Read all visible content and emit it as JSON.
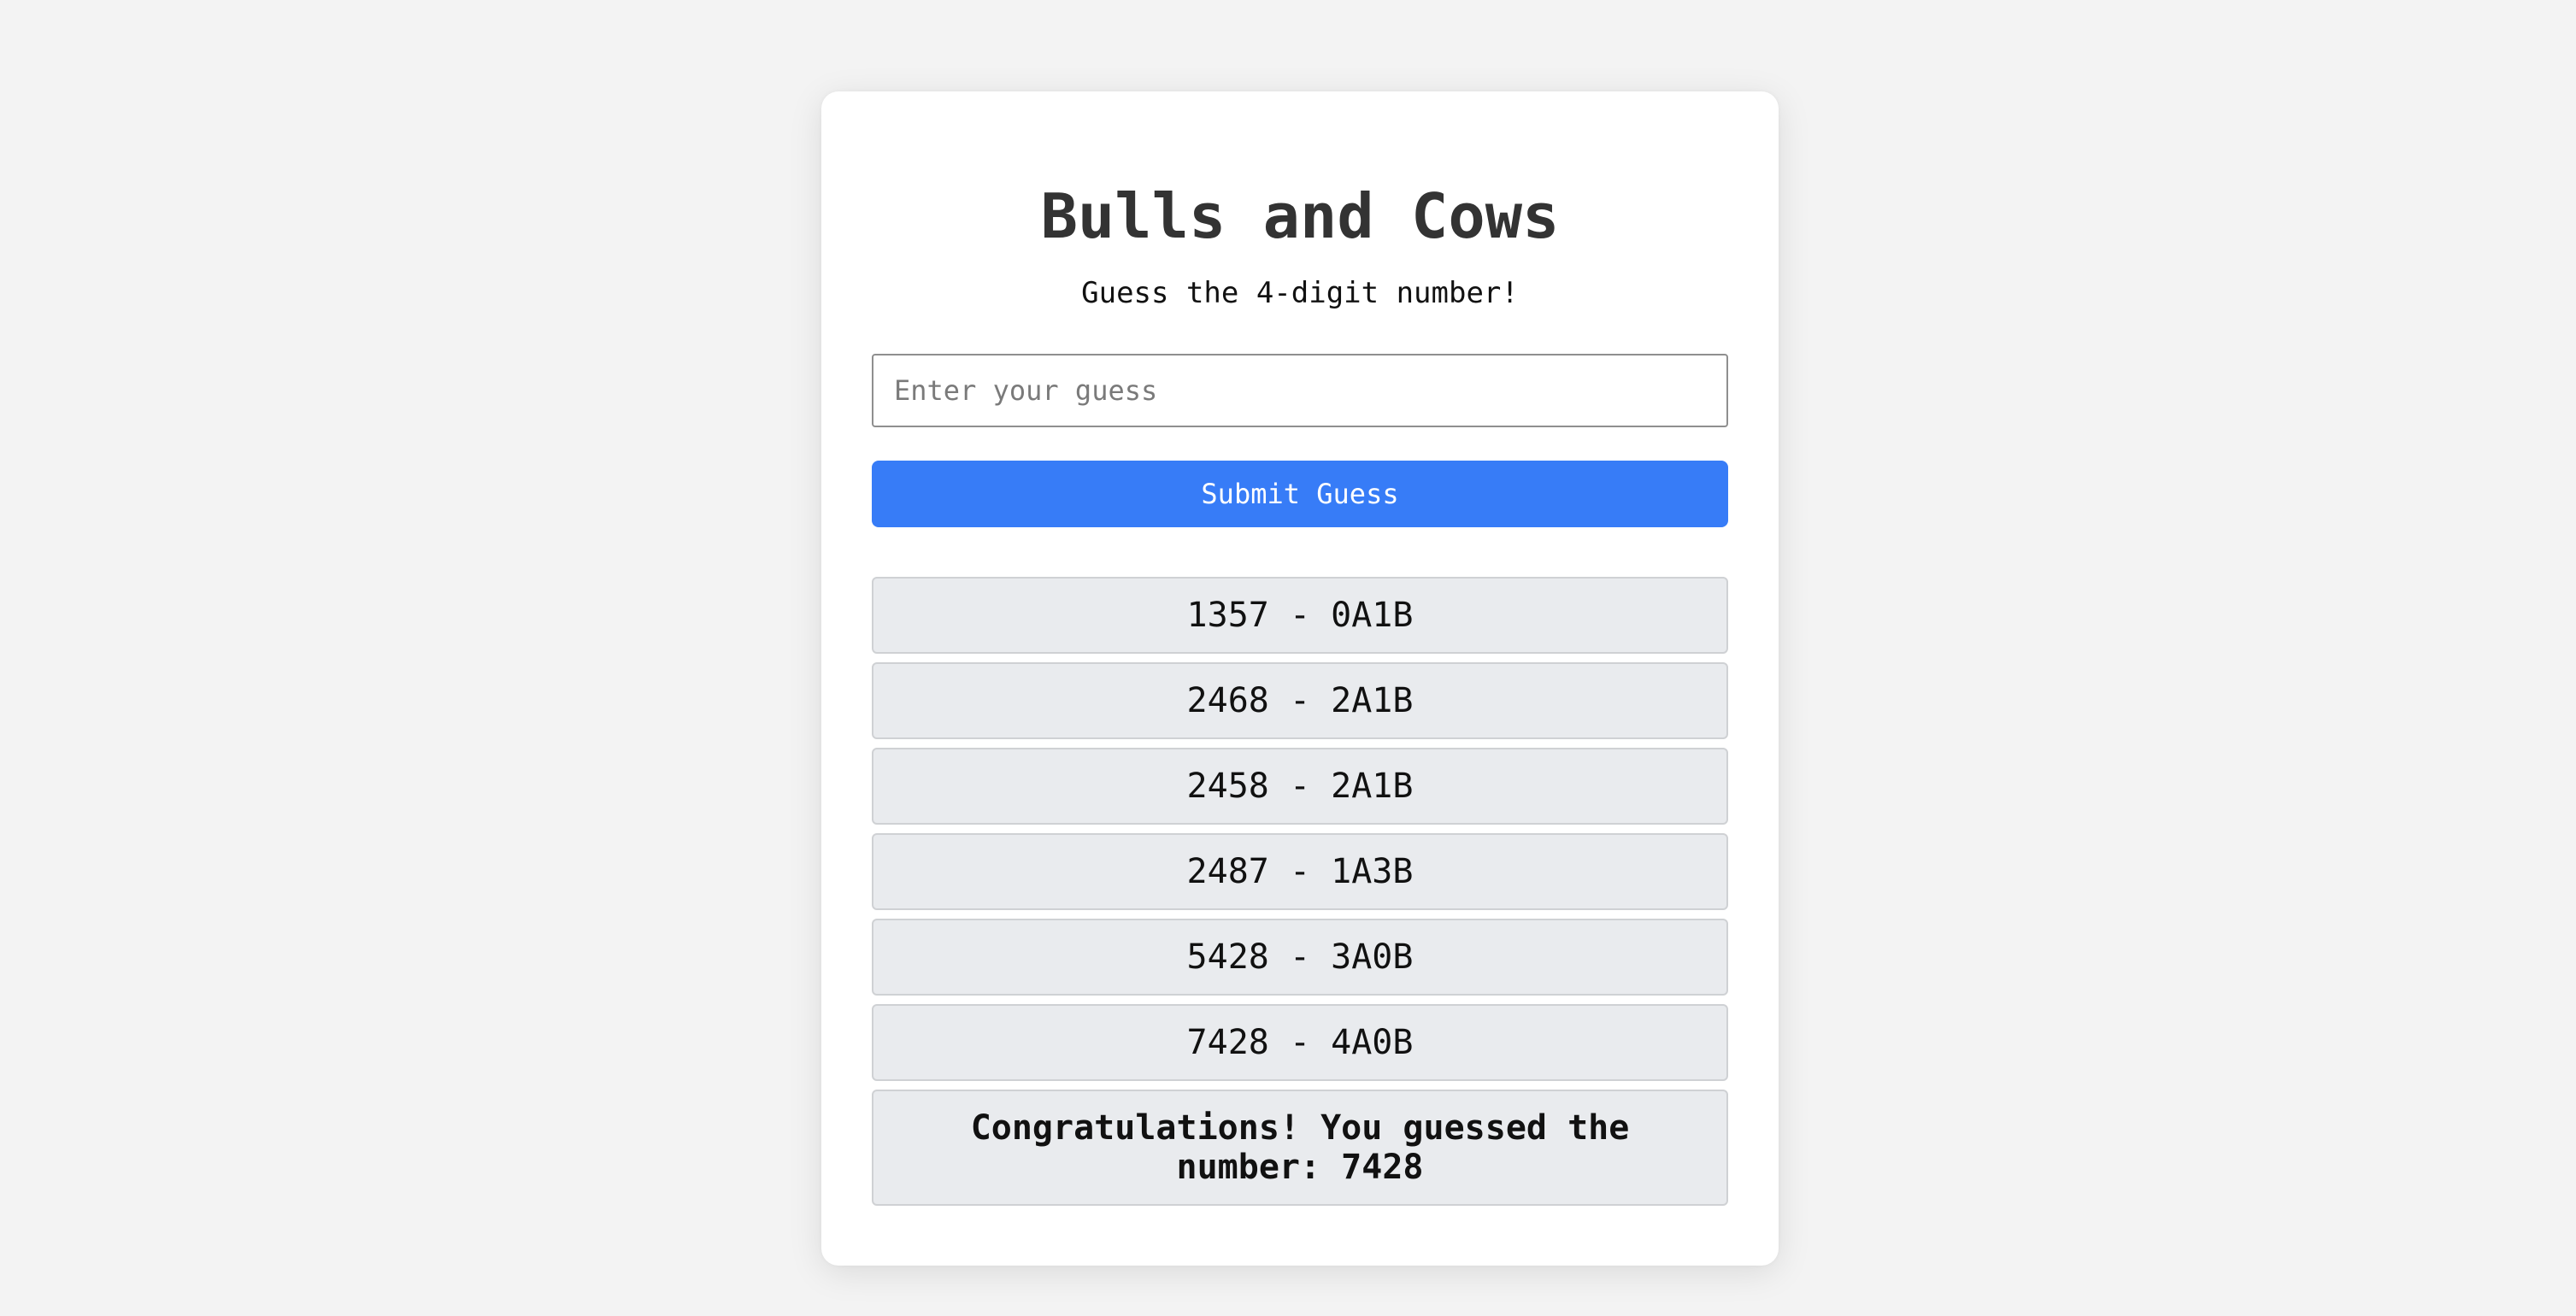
{
  "app": {
    "title": "Bulls and Cows",
    "subtitle": "Guess the 4-digit number!"
  },
  "form": {
    "input_placeholder": "Enter your guess",
    "input_value": "",
    "submit_label": "Submit Guess"
  },
  "results": {
    "guesses": [
      "1357 - 0A1B",
      "2468 - 2A1B",
      "2458 - 2A1B",
      "2487 - 1A3B",
      "5428 - 3A0B",
      "7428 - 4A0B"
    ],
    "final_message": "Congratulations! You guessed the number: 7428"
  },
  "colors": {
    "page_background": "#f3f3f3",
    "card_background": "#ffffff",
    "accent": "#377cf7",
    "result_background": "#e9ebee"
  }
}
